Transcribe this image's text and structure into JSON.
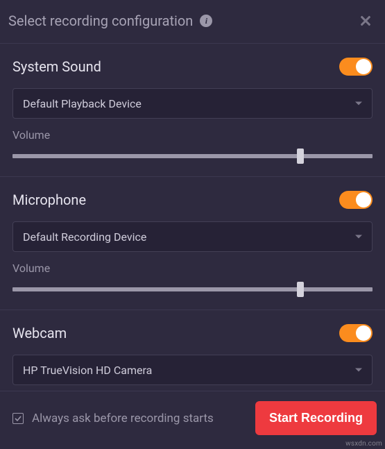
{
  "header": {
    "title": "Select recording configuration"
  },
  "system_sound": {
    "title": "System Sound",
    "device": "Default Playback Device",
    "volume_label": "Volume",
    "volume": 80,
    "enabled": true
  },
  "microphone": {
    "title": "Microphone",
    "device": "Default Recording Device",
    "volume_label": "Volume",
    "volume": 80,
    "enabled": true
  },
  "webcam": {
    "title": "Webcam",
    "device": "HP TrueVision HD Camera",
    "enabled": true
  },
  "footer": {
    "always_ask_checked": true,
    "always_ask_label": "Always ask before recording starts",
    "start_label": "Start Recording"
  },
  "watermark": "wsxdn.com"
}
